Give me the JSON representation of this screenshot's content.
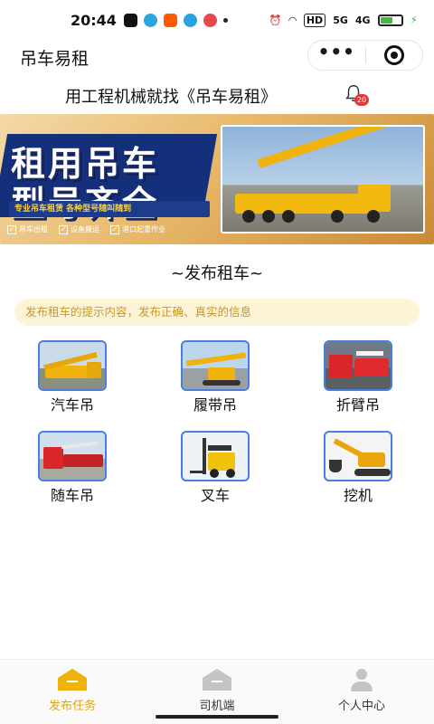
{
  "status_bar": {
    "time": "20:44",
    "signal_5g": "5G",
    "signal_4g": "4G",
    "hd": "HD",
    "battery_level": 0.55
  },
  "title_bar": {
    "title": "吊车易租",
    "menu_icon": "more-dots-icon",
    "close_icon": "target-icon"
  },
  "slogan": {
    "text": "用工程机械就找《吊车易租》",
    "notification_count": "20"
  },
  "banner": {
    "headline_line1": "租用吊车",
    "headline_line2": "型号齐全",
    "subline": "专业吊车租赁  各种型号随叫随到",
    "tags": [
      "吊车出租",
      "设备搬运",
      "港口起重作业"
    ]
  },
  "section": {
    "title": "~发布租车~",
    "tip": "发布租车的提示内容，发布正确、真实的信息"
  },
  "categories": [
    {
      "label": "汽车吊",
      "icon": "truck-crane-image"
    },
    {
      "label": "履带吊",
      "icon": "crawler-crane-image"
    },
    {
      "label": "折臂吊",
      "icon": "knuckle-boom-crane-image"
    },
    {
      "label": "随车吊",
      "icon": "truck-mounted-crane-image"
    },
    {
      "label": "叉车",
      "icon": "forklift-image"
    },
    {
      "label": "挖机",
      "icon": "excavator-image"
    }
  ],
  "bottom_nav": [
    {
      "label": "发布任务",
      "active": true
    },
    {
      "label": "司机端",
      "active": false
    },
    {
      "label": "个人中心",
      "active": false
    }
  ],
  "colors": {
    "accent": "#e2a30f",
    "tip_bg": "#fdf3d7",
    "tip_text": "#c49a2a",
    "thumb_border": "#4a7de0",
    "badge": "#e53935"
  }
}
